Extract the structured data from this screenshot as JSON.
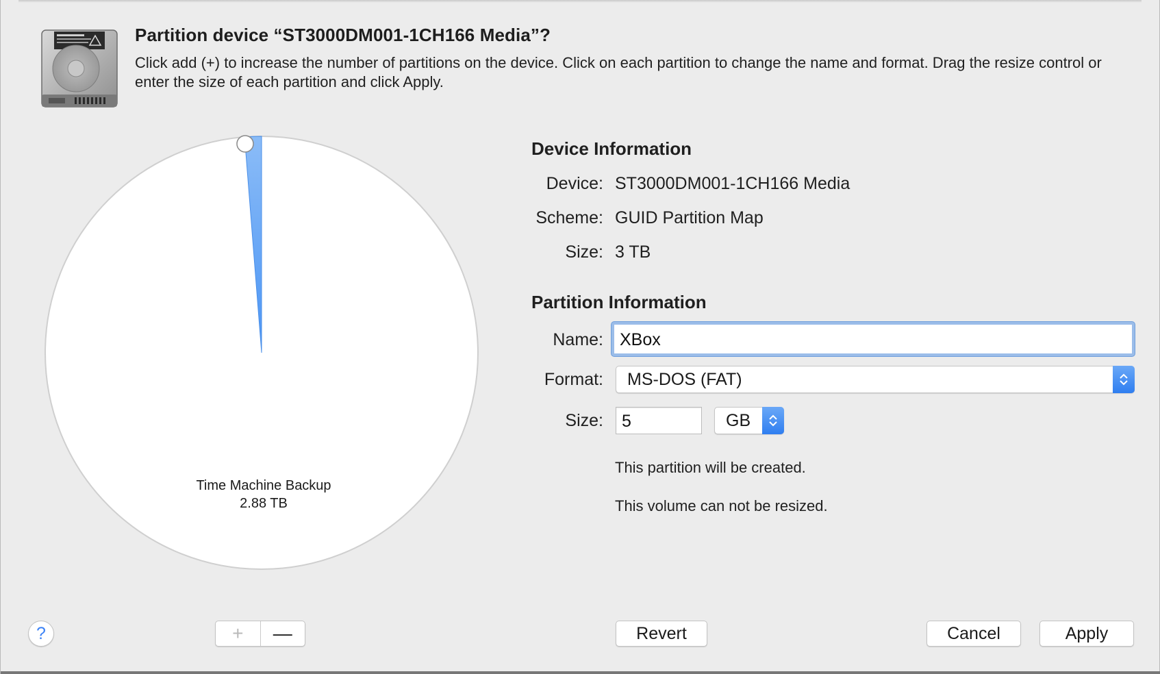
{
  "dialog": {
    "title": "Partition device “ST3000DM001-1CH166 Media”?",
    "description": "Click add (+) to increase the number of partitions on the device. Click on each partition to change the name and format. Drag the resize control or enter the size of each partition and click Apply."
  },
  "pie": {
    "partitions": [
      {
        "name": "Time Machine Backup",
        "size": "2.88 TB",
        "fraction": 0.9875,
        "color": "#ffffff"
      },
      {
        "name": "XBox",
        "size": "5 GB",
        "fraction": 0.0125,
        "color": "#4b95f5"
      }
    ],
    "label_name": "Time Machine Backup",
    "label_size": "2.88 TB"
  },
  "device_info": {
    "title": "Device Information",
    "device_label": "Device:",
    "device_value": "ST3000DM001-1CH166 Media",
    "scheme_label": "Scheme:",
    "scheme_value": "GUID Partition Map",
    "size_label": "Size:",
    "size_value": "3 TB"
  },
  "partition_info": {
    "title": "Partition Information",
    "name_label": "Name:",
    "name_value": "XBox",
    "format_label": "Format:",
    "format_value": "MS-DOS (FAT)",
    "size_label": "Size:",
    "size_value": "5",
    "size_unit": "GB",
    "note_created": "This partition will be created.",
    "note_resize": "This volume can not be resized."
  },
  "buttons": {
    "help": "?",
    "add": "+",
    "remove": "—",
    "revert": "Revert",
    "cancel": "Cancel",
    "apply": "Apply"
  },
  "colors": {
    "accent": "#3b82f6",
    "focus_ring": "#9bbde9",
    "partition_fill": "#4b95f5"
  }
}
